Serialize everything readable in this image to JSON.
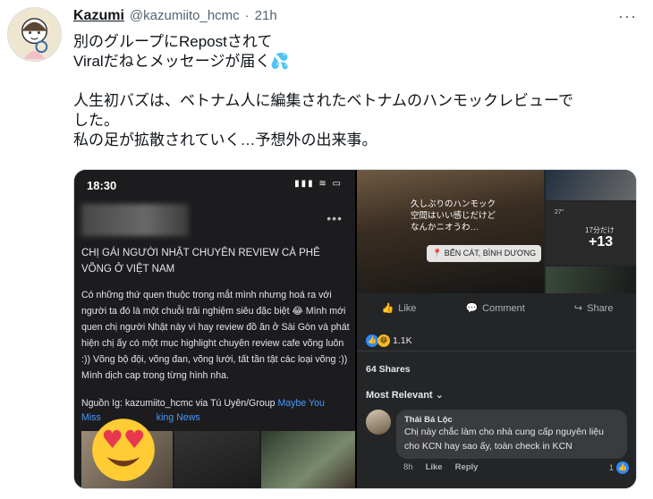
{
  "author": {
    "name": "Kazumi",
    "handle": "@kazumiito_hcmc",
    "separator": "·",
    "time": "21h"
  },
  "tweet": {
    "lines_1": [
      "別のグループにRepostされて",
      "Viralだねとメッセージが届く💦"
    ],
    "lines_2": [
      "人生初バズは、ベトナム人に編集されたベトナムのハンモックレビューで",
      "した。",
      "私の足が拡散されていく…予想外の出来事。"
    ]
  },
  "left_shot": {
    "status_time": "18:30",
    "status_icons": "▮▮▮ ≋ ▭",
    "title": "CHỊ GÁI NGƯỜI NHẬT CHUYÊN REVIEW CÀ PHÊ VÕNG Ở VIỆT NAM",
    "body": "Có những thứ quen thuộc trong mắt mình nhưng hoá ra với người ta đó là một chuỗi trải nghiệm siêu đặc biệt 😂 Mình mới quen chị người Nhật này vì hay review đồ ăn ở Sài Gòn và phát hiện chị ấy có một mục highlight chuyên review cafe võng luôn :)) Võng bộ đội, võng đan, võng lưới, tất tần tật các loại võng :)) Mình dịch cap trong từng hình nha.",
    "source_prefix": "Nguồn Ig: kazumiito_hcmc via Tú Uyên/Group ",
    "source_link": "Maybe You",
    "source_line2_prefix": "Miss",
    "source_line2_link": "king News",
    "thumb_meta": "127w"
  },
  "right_shot": {
    "caption_lines": [
      "久しぶりのハンモック",
      "空間はいい感じだけど",
      "なんかニオうわ…"
    ],
    "location": "📍 BẾN CÁT, BÌNH DƯƠNG",
    "weather_small": "27°",
    "weather_sub": "17分だけ",
    "weather_temp": "+13",
    "actions": [
      "Like",
      "Comment",
      "Share"
    ],
    "reaction_count": "1.1K",
    "shares": "64 Shares",
    "sort_label": "Most Relevant",
    "comment": {
      "name": "Thái Bá Lộc",
      "text": "Chị này chắc làm cho nhà cung cấp nguyên liệu cho KCN hay sao ấy, toàn check in KCN",
      "age": "8h",
      "like": "Like",
      "reply": "Reply",
      "like_count": "1"
    }
  }
}
